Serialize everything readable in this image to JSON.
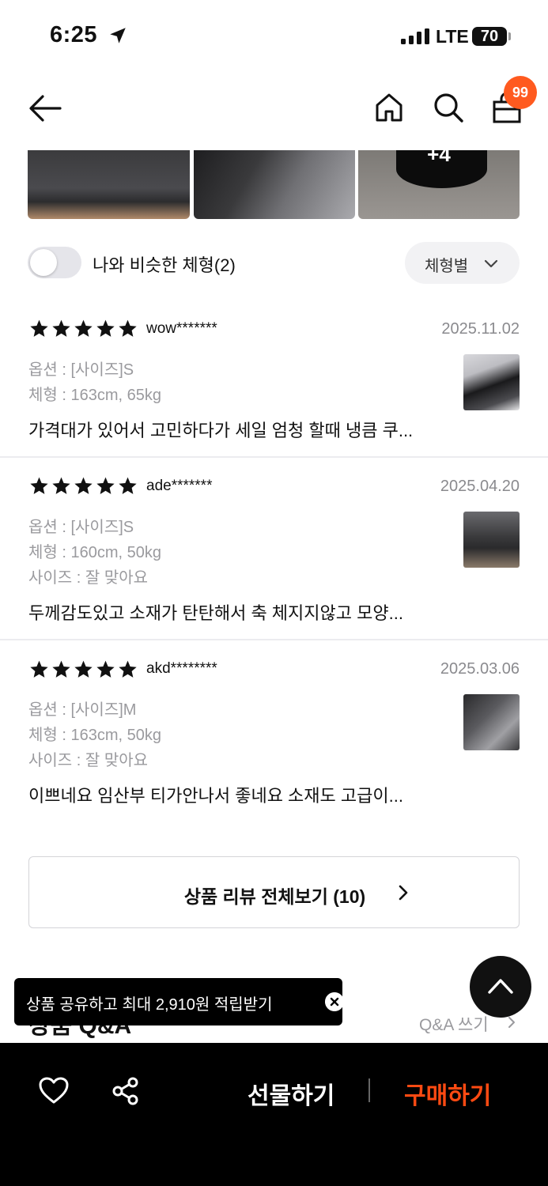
{
  "status_bar": {
    "time": "6:25",
    "network": "LTE",
    "battery": "70"
  },
  "header": {
    "cart_count": "99"
  },
  "thumbnails": {
    "more_label": "+4"
  },
  "filter": {
    "similar_label": "나와 비슷한 체형(2)",
    "sort_label": "체형별"
  },
  "reviews": [
    {
      "rating": 5,
      "user": "wow*******",
      "date": "2025.11.02",
      "option": "옵션 : [사이즈]S",
      "body": "체형 : 163cm, 65kg",
      "size": "",
      "text": "가격대가 있어서 고민하다가 세일 엄청 할때 냉큼 쿠..."
    },
    {
      "rating": 5,
      "user": "ade*******",
      "date": "2025.04.20",
      "option": "옵션 : [사이즈]S",
      "body": "체형 : 160cm, 50kg",
      "size": "사이즈 : 잘 맞아요",
      "text": "두께감도있고 소재가 탄탄해서 축 체지지않고 모양..."
    },
    {
      "rating": 5,
      "user": "akd********",
      "date": "2025.03.06",
      "option": "옵션 : [사이즈]M",
      "body": "체형 : 163cm, 50kg",
      "size": "사이즈 : 잘 맞아요",
      "text": "이쁘네요 임산부 티가안나서 좋네요 소재도 고급이..."
    }
  ],
  "view_all_label": "상품 리뷰 전체보기 (10)",
  "qa": {
    "title": "상품 Q&A",
    "write_label": "Q&A 쓰기"
  },
  "toast": {
    "text": "상품 공유하고 최대 2,910원 적립받기"
  },
  "bottom_bar": {
    "gift_label": "선물하기",
    "buy_label": "구매하기"
  },
  "colors": {
    "accent": "#ff4a12",
    "badge": "#ff5a1f"
  }
}
